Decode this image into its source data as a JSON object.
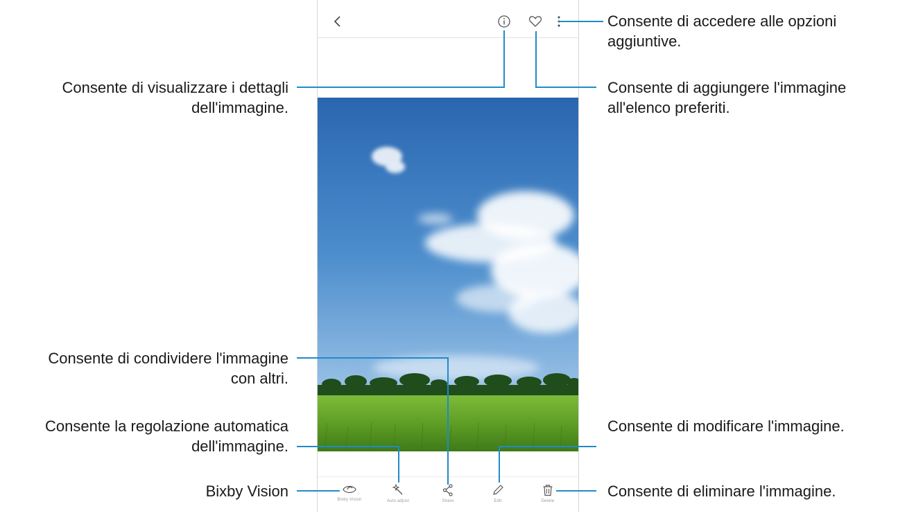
{
  "callouts": {
    "more_options": [
      "Consente di accedere alle opzioni",
      "aggiuntive."
    ],
    "details": [
      "Consente di visualizzare i dettagli",
      "dell'immagine."
    ],
    "favourite": [
      "Consente di aggiungere l'immagine",
      "all'elenco preferiti."
    ],
    "share": [
      "Consente di condividere l'immagine",
      "con altri."
    ],
    "auto_adjust": [
      "Consente la regolazione automatica",
      "dell'immagine."
    ],
    "edit": "Consente di modificare l'immagine.",
    "bixby": "Bixby Vision",
    "delete": "Consente di eliminare l'immagine."
  },
  "toolbar": {
    "back_icon": "chevron-left-icon",
    "details_icon": "info-icon",
    "favourite_icon": "heart-icon",
    "more_icon": "more-vertical-icon"
  },
  "bottom_bar": [
    {
      "icon": "bixby-vision-icon",
      "label": "Bixby Vision"
    },
    {
      "icon": "auto-adjust-icon",
      "label": "Auto adjust"
    },
    {
      "icon": "share-icon",
      "label": "Share"
    },
    {
      "icon": "edit-icon",
      "label": "Edit"
    },
    {
      "icon": "delete-icon",
      "label": "Delete"
    }
  ],
  "colors": {
    "leader_line": "#1f8bc9",
    "sky_top": "#2a6bb6",
    "sky_bottom": "#a8c9e8",
    "field": "#6fae2c"
  }
}
